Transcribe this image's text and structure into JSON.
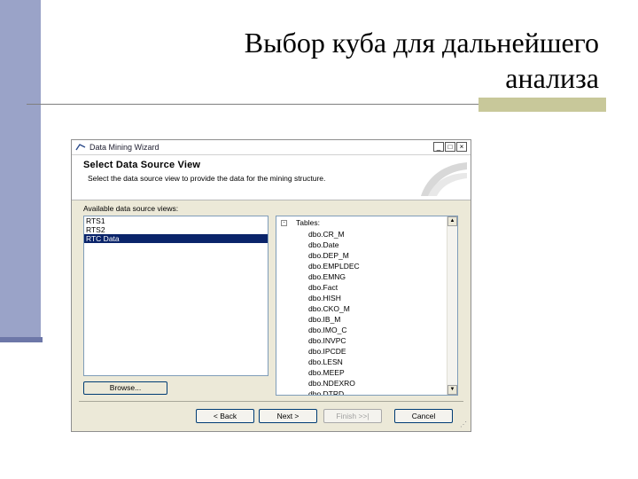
{
  "slide": {
    "title_line1": "Выбор куба для дальнейшего",
    "title_line2": "анализа"
  },
  "window": {
    "title": "Data Mining Wizard",
    "controls": [
      "_",
      "□",
      "×"
    ]
  },
  "wizard": {
    "heading": "Select Data Source View",
    "subheading": "Select the data source view to provide the data for the mining structure.",
    "available_label": "Available data source views:",
    "data_source_views": [
      {
        "label": "RTS1",
        "selected": false
      },
      {
        "label": "RTS2",
        "selected": false
      },
      {
        "label": "RTC Data",
        "selected": true
      }
    ],
    "tree_root": "Tables:",
    "tree_toggle": "-",
    "tables": [
      "dbo.CR_M",
      "dbo.Date",
      "dbo.DEP_M",
      "dbo.EMPLDEC",
      "dbo.EMNG",
      "dbo.Fact",
      "dbo.HISH",
      "dbo.CKO_M",
      "dbo.IB_M",
      "dbo.IMO_C",
      "dbo.INVPC",
      "dbo.IPCDE",
      "dbo.LESN",
      "dbo.MEEP",
      "dbo.NDEXRO",
      "dbo.DTRD"
    ],
    "browse_label": "Browse...",
    "back_label": "< Back",
    "next_label": "Next >",
    "finish_label": "Finish >>|",
    "cancel_label": "Cancel"
  },
  "colors": {
    "selection": "#0a246a",
    "dialog_bg": "#ece9d8",
    "slide_bar": "#9aa3c8",
    "slide_accent": "#c8c89a"
  }
}
